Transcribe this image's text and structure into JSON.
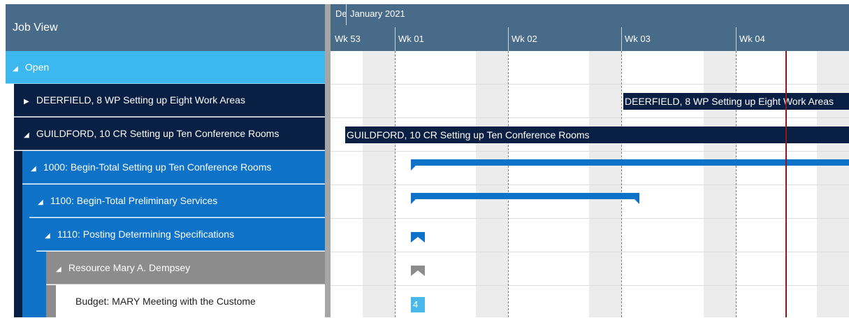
{
  "left_panel": {
    "title": "Job View",
    "rows": [
      {
        "label": "Open",
        "expanded": true,
        "color": "#3db8ef"
      },
      {
        "label": "DEERFIELD, 8 WP Setting up Eight Work Areas",
        "expanded": false,
        "color": "#0a1f44"
      },
      {
        "label": "GUILDFORD, 10 CR Setting up Ten Conference Rooms",
        "expanded": true,
        "color": "#0a1f44"
      },
      {
        "label": "1000: Begin-Total Setting up Ten Conference Rooms",
        "expanded": true,
        "color": "#0d72c8"
      },
      {
        "label": "1100: Begin-Total Preliminary Services",
        "expanded": true,
        "color": "#0d72c8"
      },
      {
        "label": "1110: Posting Determining Specifications",
        "expanded": true,
        "color": "#0d72c8"
      },
      {
        "label": "Resource Mary A. Dempsey",
        "expanded": true,
        "color": "#8c8c8c"
      },
      {
        "label": "Budget: MARY Meeting with the Custome",
        "color": "#ffffff"
      }
    ]
  },
  "timeline": {
    "months": [
      {
        "label": "De"
      },
      {
        "label": "January 2021"
      }
    ],
    "weeks": [
      "Wk 53",
      "Wk 01",
      "Wk 02",
      "Wk 03",
      "Wk 04"
    ],
    "bars": {
      "deerfield": "DEERFIELD, 8 WP Setting up Eight Work Areas",
      "guildford": "GUILDFORD, 10 CR Setting up Ten Conference Rooms"
    },
    "budget_value": "4"
  },
  "colors": {
    "header": "#486b8a",
    "open": "#3db8ef",
    "job": "#0a1f44",
    "task": "#0d72c8",
    "resource": "#8c8c8c",
    "today_line": "#8b1a1a",
    "budget": "#4ab8ea"
  }
}
